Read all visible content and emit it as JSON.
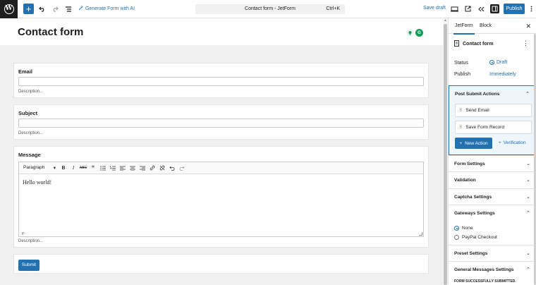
{
  "topbar": {
    "ai_label": "Generate Form with AI",
    "command_title": "Contact form - JetForm",
    "command_shortcut": "Ctrl+K",
    "save_draft": "Save draft",
    "publish": "Publish"
  },
  "canvas": {
    "title": "Contact form",
    "fields": [
      {
        "label": "Email",
        "description": "Description..."
      },
      {
        "label": "Subject",
        "description": "Description..."
      },
      {
        "label": "Message",
        "description": "Description..."
      }
    ],
    "editor": {
      "format": "Paragraph",
      "content": "Hello world!",
      "path": "P"
    },
    "submit_label": "Submit"
  },
  "sidebar": {
    "tabs": [
      "JetForm",
      "Block"
    ],
    "document_title": "Contact form",
    "status_label": "Status",
    "status_value": "Draft",
    "publish_label": "Publish",
    "publish_value": "Immediately",
    "post_submit": {
      "title": "Post Submit Actions",
      "actions": [
        "Send Email",
        "Save Form Record"
      ],
      "new_action": "New Action",
      "verification": "Verification"
    },
    "sections": [
      "Form Settings",
      "Validation",
      "Captcha Settings",
      "Gateways Settings",
      "Preset Settings",
      "General Messages Settings"
    ],
    "gateways": {
      "options": [
        "None",
        "PayPal Checkout"
      ],
      "selected": "None"
    },
    "message_preview": "FORM SUCCESSFULLY SUBMITTED."
  },
  "colors": {
    "accent": "#2271b1",
    "dark": "#1e1e1e",
    "canvas_bg": "#f0f0f0"
  }
}
